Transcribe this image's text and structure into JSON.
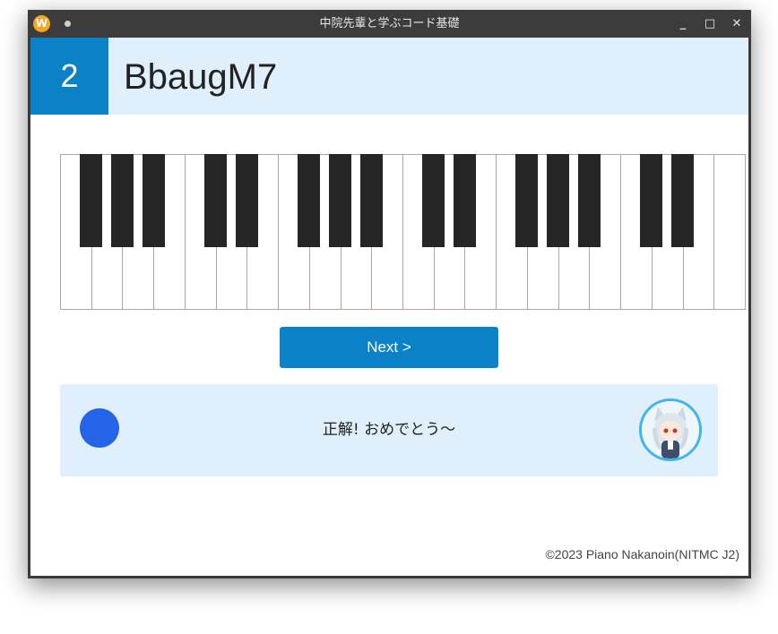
{
  "window": {
    "title": "中院先輩と学ぶコード基礎",
    "app_icon_letter": "W",
    "minimize_glyph": "_",
    "maximize_glyph": "□",
    "close_glyph": "✕"
  },
  "question": {
    "number": "2",
    "chord_name": "BbaugM7"
  },
  "keyboard": {
    "white_key_count": 22,
    "highlighted_keys": []
  },
  "next_button": {
    "label": "Next >"
  },
  "feedback": {
    "message": "正解! おめでとう～",
    "status_color": "#2563e8",
    "avatar_icon": "character-avatar-icon"
  },
  "footer": {
    "copyright": "©2023 Piano Nakanoin(NITMC J2)"
  },
  "colors": {
    "accent": "#0b82c8",
    "header_bg": "#dff0fc"
  }
}
